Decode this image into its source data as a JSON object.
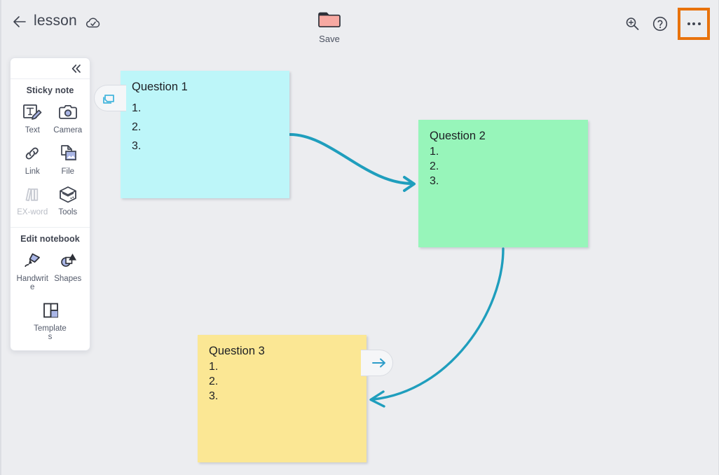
{
  "header": {
    "back_icon": "arrow-left-icon",
    "title": "lesson",
    "cloud_icon": "cloud-sync-icon",
    "save": {
      "icon": "folder-icon",
      "label": "Save",
      "folder_color": "#f8a9a2"
    },
    "zoom_icon": "zoom-in-icon",
    "help_icon": "help-circle-icon",
    "more_icon": "more-horizontal-icon",
    "highlight_color": "#e8720c",
    "tab_indicator_color": "#f8a9a2"
  },
  "tool_panel": {
    "collapse_icon": "chevron-double-left-icon",
    "sections": [
      {
        "title": "Sticky note",
        "items": [
          {
            "label": "Text",
            "icon": "text-pen-icon",
            "disabled": false
          },
          {
            "label": "Camera",
            "icon": "camera-icon",
            "disabled": false
          },
          {
            "label": "Link",
            "icon": "link-chain-icon",
            "disabled": false
          },
          {
            "label": "File",
            "icon": "file-image-icon",
            "disabled": false
          },
          {
            "label": "EX-word",
            "icon": "books-icon",
            "disabled": true
          },
          {
            "label": "Tools",
            "icon": "box-tools-icon",
            "disabled": false
          }
        ]
      },
      {
        "title": "Edit notebook",
        "items": [
          {
            "label": "Handwrite",
            "icon": "marker-pen-icon",
            "disabled": false
          },
          {
            "label": "Shapes",
            "icon": "shapes-icon",
            "disabled": false
          },
          {
            "label": "Templates",
            "icon": "template-grid-icon",
            "disabled": false
          }
        ]
      }
    ]
  },
  "canvas": {
    "connector_color": "#1f9ebd",
    "notes": [
      {
        "title": "Question 1",
        "bullets": [
          "1.",
          "2.",
          "3."
        ],
        "color": "#bdf6f9",
        "badge": {
          "position": "left",
          "icon": "duplicate-windows-icon"
        }
      },
      {
        "title": "Question 2",
        "bullets": [
          "1.",
          "2.",
          "3."
        ],
        "color": "#97f5ba",
        "badge": null
      },
      {
        "title": "Question 3",
        "bullets": [
          "1.",
          "2.",
          "3."
        ],
        "color": "#fbe794",
        "badge": {
          "position": "right",
          "icon": "arrow-right-icon"
        }
      }
    ]
  }
}
